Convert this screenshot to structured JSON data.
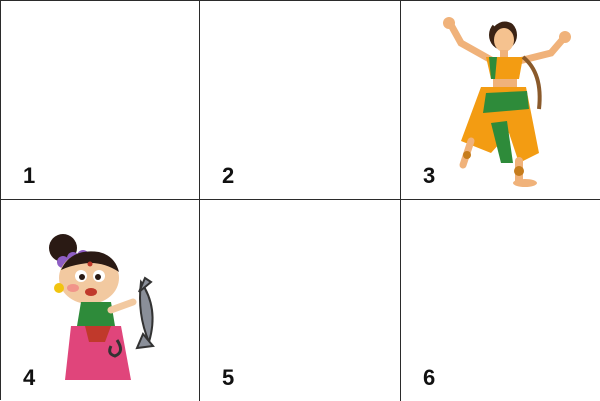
{
  "cells": [
    {
      "number": "1"
    },
    {
      "number": "2"
    },
    {
      "number": "3",
      "illustration": "classical-dancer-figure"
    },
    {
      "number": "4",
      "illustration": "woman-with-fish-figure"
    },
    {
      "number": "5"
    },
    {
      "number": "6"
    }
  ],
  "colors": {
    "grid_line": "#2b2b2b",
    "background": "#ffffff",
    "number_text": "#111111"
  }
}
